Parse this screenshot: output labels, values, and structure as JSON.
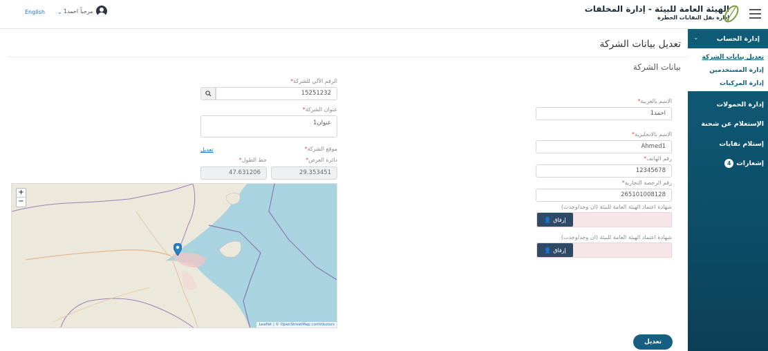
{
  "header": {
    "org_title": "الهيئة العامة للبيئة - إدارة المخلفات",
    "org_subtitle": "إدارة نقل النفايات الخطرة",
    "welcome": "مرحباً",
    "username": "احمد1",
    "language": "English"
  },
  "sidebar": {
    "account_menu": "إدارة الحساب",
    "sub_items": [
      "تعديل بيانات الشركة",
      "إدارة المستخدمين",
      "إدارة المركبات"
    ],
    "items": [
      "إدارة الحمولات",
      "الإستعلام عن شحنة",
      "إستلام نفايات",
      "إشعارات"
    ],
    "notifications_count": "4",
    "active_color": "#12617f"
  },
  "page": {
    "title": "تعديل بيانات الشركة",
    "section_title": "بيانات الشركة",
    "submit_label": "تعديل"
  },
  "form": {
    "name_ar_label": "الاسم بالعربية",
    "name_ar_value": "احمد1",
    "name_en_label": "الاسم بالانجليزية",
    "name_en_value": "Ahmed1",
    "phone_label": "رقم الهاتف",
    "phone_value": "12345678",
    "license_label": "رقم الرخصة التجارية",
    "license_value": "265101008128",
    "cert1_label": "شهادة اعتماد الهيئة العامة للبيئة (ان وجد/وجدت)",
    "cert2_label": "شهادة اعتماد الهيئة العامة للبيئة (ان وجد/وجدت)",
    "attach_label": "إرفاق",
    "auto_number_label": "الرقم الآلي للشركة",
    "auto_number_value": "15251232",
    "address_label": "عنوان الشركة",
    "address_value": "عنوان1",
    "location_label": "موقع الشركة",
    "edit_link": "تعديل",
    "latitude_label": "دائرة العرض",
    "latitude_value": "29.353451",
    "longitude_label": "خط الطول",
    "longitude_value": "47.631206"
  },
  "map": {
    "zoom_in": "+",
    "zoom_out": "−",
    "attribution": "Leaflet | © OpenStreetMap contributors",
    "sea_color": "#a9d3df",
    "land_color": "#ece8dc"
  }
}
